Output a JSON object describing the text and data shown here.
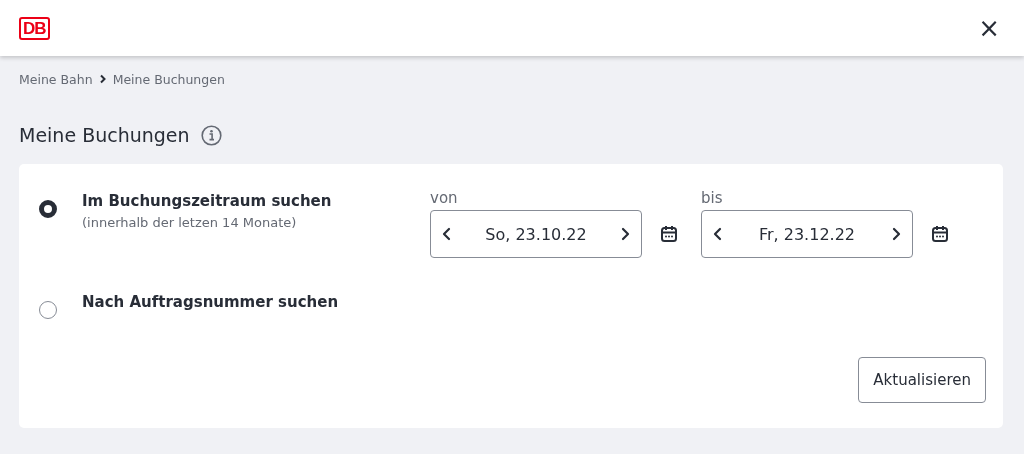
{
  "header": {
    "logo_text": "DB",
    "close": "×"
  },
  "breadcrumb": [
    {
      "label": "Meine Bahn"
    },
    {
      "label": "Meine Buchungen"
    }
  ],
  "page_title": "Meine Buchungen",
  "search_options": [
    {
      "label": "Im Buchungszeitraum suchen",
      "hint": "(innerhalb der letzen 14 Monate)",
      "selected": true
    },
    {
      "label": "Nach Auftragsnummer suchen",
      "selected": false
    }
  ],
  "date_fields": [
    {
      "label": "von",
      "value": "So, 23.10.22"
    },
    {
      "label": "bis",
      "value": "Fr, 23.12.22"
    }
  ],
  "submit_button": "Aktualisieren"
}
